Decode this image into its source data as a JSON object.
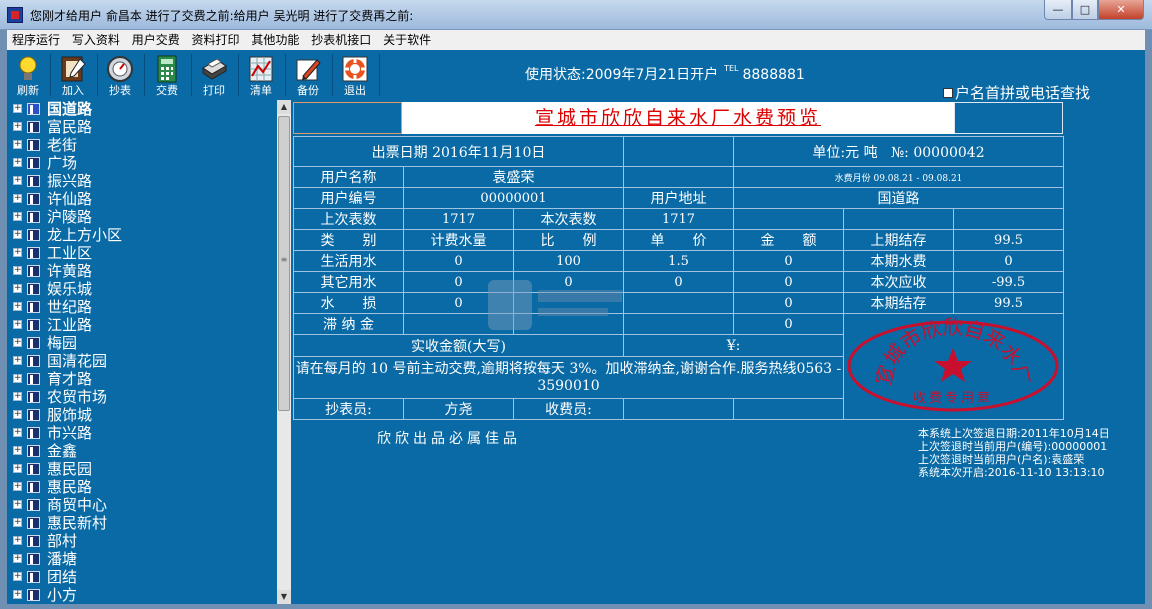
{
  "window": {
    "title": "您刚才给用户 俞昌本 进行了交费之前:给用户 吴光明 进行了交费再之前:",
    "min_glyph": "—",
    "max_glyph": "□",
    "close_glyph": "✕"
  },
  "menu": [
    "程序运行",
    "写入资料",
    "用户交费",
    "资料打印",
    "其他功能",
    "抄表机接口",
    "关于软件"
  ],
  "toolbar": [
    {
      "id": "refresh",
      "label": "刷新",
      "icon": "lightbulb-icon"
    },
    {
      "id": "add",
      "label": "加入",
      "icon": "edit-document-icon"
    },
    {
      "id": "read",
      "label": "抄表",
      "icon": "meter-icon"
    },
    {
      "id": "pay",
      "label": "交费",
      "icon": "calculator-icon"
    },
    {
      "id": "print",
      "label": "打印",
      "icon": "printer-icon"
    },
    {
      "id": "list",
      "label": "清单",
      "icon": "chart-sheet-icon"
    },
    {
      "id": "backup",
      "label": "备份",
      "icon": "backup-pen-icon"
    },
    {
      "id": "exit",
      "label": "退出",
      "icon": "lifebuoy-icon"
    }
  ],
  "status": {
    "text": "使用状态:2009年7月21日开户",
    "tel_label": "TEL",
    "tel_value": "8888881"
  },
  "search_option": "户名首拼或电话查找",
  "tree": {
    "selected": "国道路",
    "items": [
      "国道路",
      "富民路",
      "老街",
      "广场",
      "振兴路",
      "许仙路",
      "沪陵路",
      "龙上方小区",
      "工业区",
      "许黄路",
      "娱乐城",
      "世纪路",
      "江业路",
      "梅园",
      "国清花园",
      "育才路",
      "农贸市场",
      "服饰城",
      "市兴路",
      "金鑫",
      "惠民园",
      "惠民路",
      "商贸中心",
      "惠民新村",
      "部村",
      "潘塘",
      "团结",
      "小方"
    ]
  },
  "report": {
    "title": "宣城市欣欣自来水厂水费预览",
    "issue_date": "出票日期 2016年11月10日",
    "unit": "单位:元 吨",
    "no_label": "№:",
    "no_value": "00000042",
    "user_name_label": "用户名称",
    "user_name": "袁盛荣",
    "water_month": "水费月份 09.08.21 - 09.08.21",
    "user_id_label": "用户编号",
    "user_id": "00000001",
    "address_label": "用户地址",
    "address": "国道路",
    "last_reading_label": "上次表数",
    "last_reading": "1717",
    "this_reading_label": "本次表数",
    "this_reading": "1717",
    "headers": [
      "类　　别",
      "计费水量",
      "比　　例",
      "单　　价",
      "金　　额"
    ],
    "rows": [
      {
        "type": "生活用水",
        "qty": "0",
        "ratio": "100",
        "price": "1.5",
        "amount": "0",
        "side_label": "本期水费",
        "side_value": "0"
      },
      {
        "type": "其它用水",
        "qty": "0",
        "ratio": "0",
        "price": "0",
        "amount": "0",
        "side_label": "本次应收",
        "side_value": "-99.5"
      },
      {
        "type": "水　　损",
        "qty": "0",
        "ratio": "",
        "price": "",
        "amount": "0",
        "side_label": "本期结存",
        "side_value": "99.5"
      }
    ],
    "prev_balance_label": "上期结存",
    "prev_balance": "99.5",
    "late_fee_label": "滞 纳 金",
    "late_fee": "0",
    "actual_label": "实收金额(大写)",
    "currency": "¥:",
    "notice": "请在每月的 10 号前主动交费,逾期将按每天 3%。加收滞纳金,谢谢合作.服务热线0563 - 3590010",
    "reader_label": "抄表员:",
    "reader": "方尧",
    "cashier_label": "收费员:",
    "cashier": ""
  },
  "seal": {
    "text": "宣城市欣欣自来水厂",
    "bottom": "收费专用章",
    "color": "#c8102e"
  },
  "slogan": "欣欣出品必属佳品",
  "sysinfo": [
    "本系统上次签退日期:2011年10月14日",
    "上次签退时当前用户(编号):00000001",
    "上次签退时当前用户(户名):袁盛荣",
    "系统本次开启:2016-11-10 13:13:10"
  ],
  "colors": {
    "panel": "#0a6aa5",
    "title_red": "#dd0000"
  }
}
